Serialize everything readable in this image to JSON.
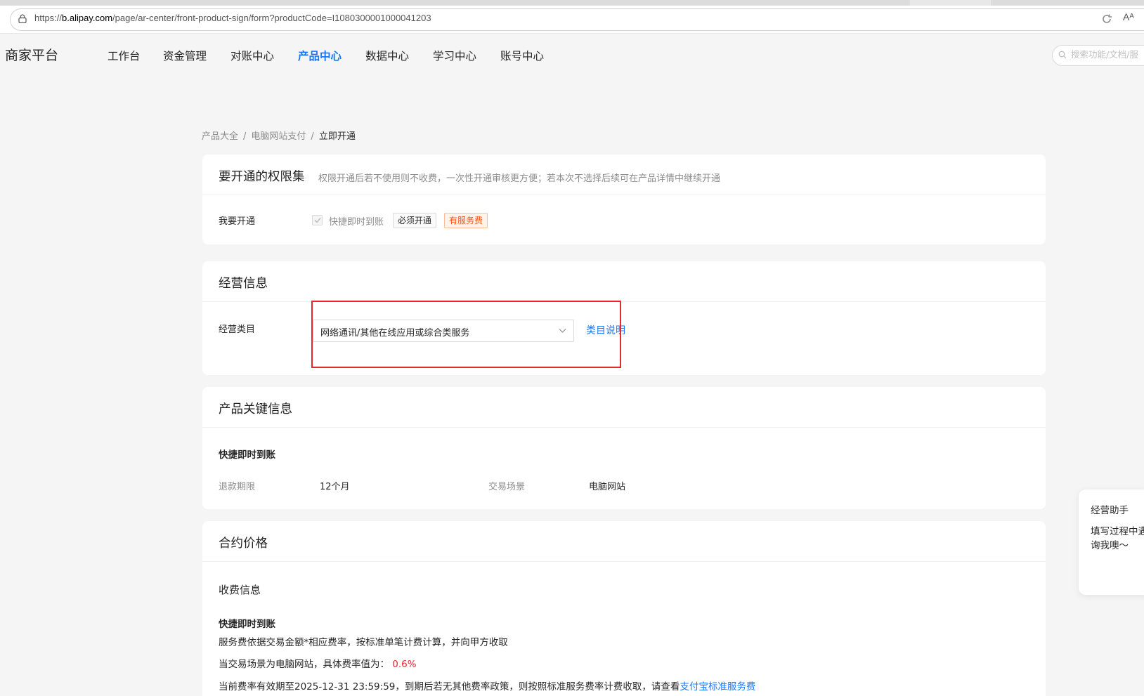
{
  "browser": {
    "url_prefix": "https://",
    "url_host": "b.alipay.com",
    "url_path": "/page/ar-center/front-product-sign/form?productCode=I1080300001000041203",
    "read_icon": "Aᴬ"
  },
  "header": {
    "brand": "商家平台",
    "nav": [
      "工作台",
      "资金管理",
      "对账中心",
      "产品中心",
      "数据中心",
      "学习中心",
      "账号中心"
    ],
    "active_nav": "产品中心",
    "search_placeholder": "搜索功能/文档/服"
  },
  "breadcrumb": {
    "items": [
      "产品大全",
      "电脑网站支付"
    ],
    "current": "立即开通",
    "separator": "/"
  },
  "permissions_card": {
    "title": "要开通的权限集",
    "subtitle": "权限开通后若不使用则不收费，一次性开通审核更方便；若本次不选择后续可在产品详情中继续开通",
    "row_label": "我要开通",
    "checkbox_label": "快捷即时到账",
    "checked": true,
    "tag_required": "必须开通",
    "tag_fee": "有服务费"
  },
  "business_card": {
    "title": "经营信息",
    "field_label": "经营类目",
    "select_value": "网络通讯/其他在线应用或综合类服务",
    "category_link": "类目说明"
  },
  "key_info_card": {
    "title": "产品关键信息",
    "product_name": "快捷即时到账",
    "refund_label": "退款期限",
    "refund_value": "12个月",
    "scene_label": "交易场景",
    "scene_value": "电脑网站"
  },
  "price_card": {
    "title": "合约价格",
    "fee_section": "收费信息",
    "product_name": "快捷即时到账",
    "line1": "服务费依据交易金额*相应费率，按标准单笔计费计算，并向甲方收取",
    "line2_prefix": "当交易场景为电脑网站，具体费率值为：",
    "rate": "0.6%",
    "line3_prefix": "当前费率有效期至2025-12-31 23:59:59，到期后若无其他费率政策，则按照标准服务费率计费收取，请查看",
    "line3_link": "支付宝标准服务费"
  },
  "assistant": {
    "title": "经营助手",
    "text": "填写过程中遇\n询我噢～"
  },
  "colors": {
    "accent": "#1677ff",
    "highlight": "#e8262d",
    "fee_tag": "#fa541c",
    "rate": "#f5222d"
  }
}
